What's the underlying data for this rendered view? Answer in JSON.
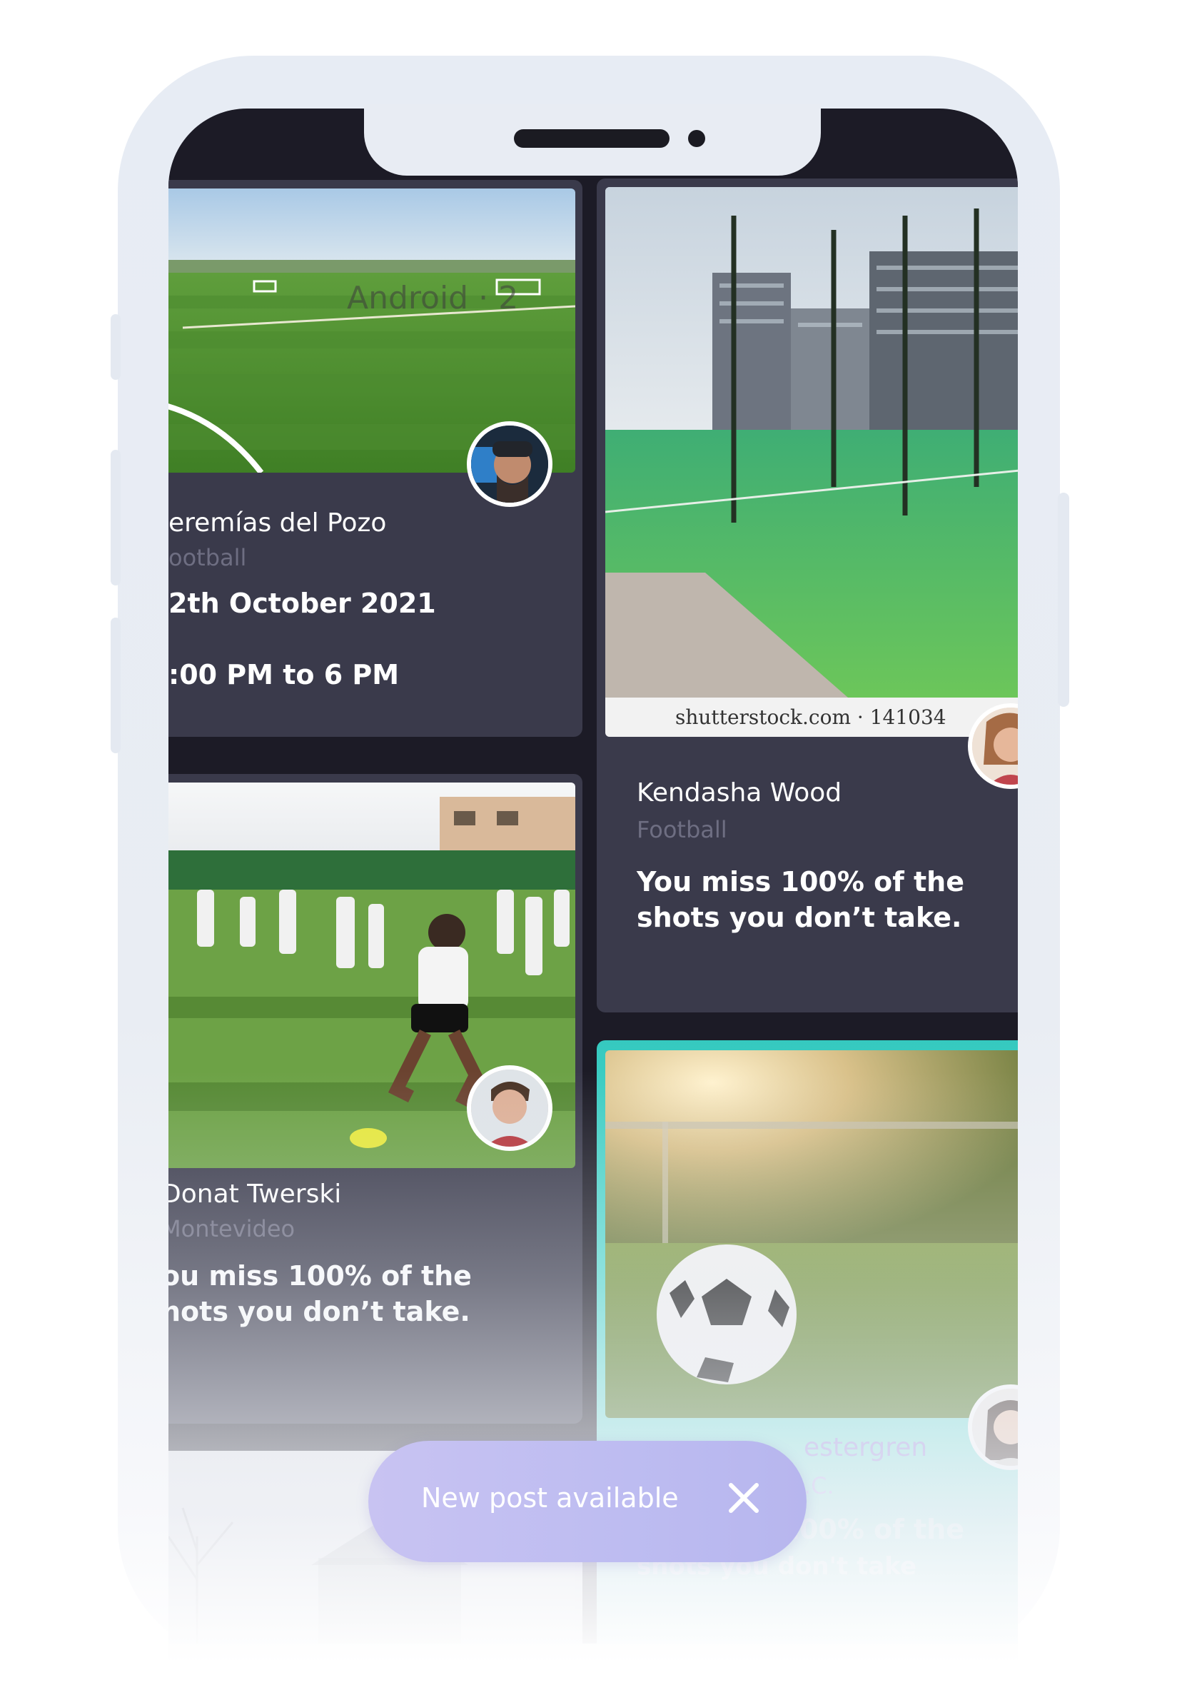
{
  "feed": {
    "cards": [
      {
        "name": "eremías del Pozo",
        "sub": "ootball",
        "line1": "2th October 2021",
        "line2": ":00 PM to 6 PM",
        "watermark": "Android · 2"
      },
      {
        "name": "Kendasha Wood",
        "sub": "Football",
        "quote": "You miss 100% of the shots you don’t take.",
        "watermark": "shutterstock.com · 141034"
      },
      {
        "name": "Donat Twerski",
        "sub": "Montevideo",
        "quote": "ou miss 100% of the\nhots you don’t take."
      },
      {
        "name": "estergren",
        "sub": ".C.",
        "quote": "You miss 100% of the",
        "quote2": "shots you don't take"
      }
    ]
  },
  "toast": {
    "label": "New post available"
  },
  "icons": {
    "close": "close-icon",
    "avatar": "avatar"
  },
  "colors": {
    "card": "#3a3a4b",
    "accent": "#35c9bf",
    "toast": "#c0bdf0",
    "screen": "#1c1b26"
  }
}
